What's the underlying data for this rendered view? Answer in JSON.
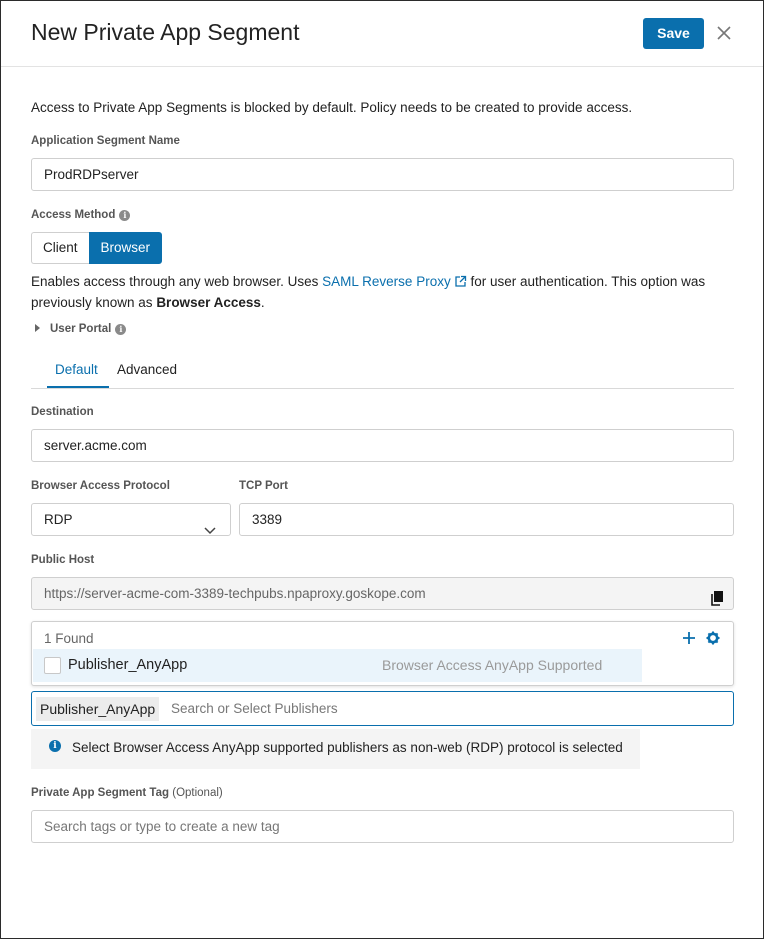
{
  "dialog": {
    "title": "New Private App Segment",
    "save_label": "Save",
    "close_icon": "close-icon"
  },
  "intro_text": "Access to Private App Segments is blocked by default. Policy needs to be created to provide access.",
  "segment_name": {
    "label": "Application Segment Name",
    "value": "ProdRDPserver"
  },
  "access_method": {
    "label": "Access Method",
    "options": [
      "Client",
      "Browser"
    ],
    "selected": "Browser"
  },
  "browser_description": {
    "part1": "Enables access through any web browser. Uses ",
    "link": "SAML Reverse Proxy",
    "part2": " for user authentication. This option was",
    "part3": "previously known as ",
    "bold": "Browser Access",
    "part4": "."
  },
  "user_portal": {
    "label": "User Portal"
  },
  "tabs": {
    "items": [
      "Default",
      "Advanced"
    ],
    "active": "Default"
  },
  "destination": {
    "label": "Destination",
    "value": "server.acme.com"
  },
  "protocol": {
    "label": "Browser Access Protocol",
    "value": "RDP"
  },
  "tcp_port": {
    "label": "TCP Port",
    "value": "3389"
  },
  "public_host": {
    "label": "Public Host",
    "value": "https://server-acme-com-3389-techpubs.npaproxy.goskope.com"
  },
  "publisher_dropdown": {
    "found_text": "1 Found",
    "items": [
      {
        "name": "Publisher_AnyApp",
        "note": "Browser Access AnyApp Supported"
      }
    ]
  },
  "publisher_select": {
    "chip": "Publisher_AnyApp",
    "placeholder": "Search or Select Publishers"
  },
  "publisher_info": "Select Browser Access AnyApp supported publishers as non-web (RDP) protocol is selected",
  "tag": {
    "label": "Private App Segment Tag",
    "optional": "(Optional)",
    "placeholder": "Search tags or type to create a new tag"
  },
  "colors": {
    "accent": "#0a6fad",
    "selected_row": "#eaf4fb"
  }
}
